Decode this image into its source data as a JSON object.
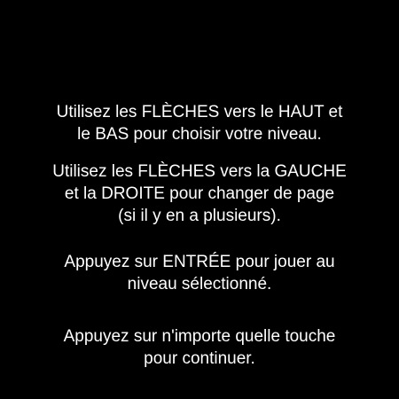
{
  "instructions": {
    "paragraphs": [
      {
        "lines": [
          "Utilisez les FLÈCHES vers le HAUT et",
          "le BAS pour choisir votre niveau."
        ]
      },
      {
        "lines": [
          "Utilisez les FLÈCHES vers la GAUCHE",
          "et la DROITE pour changer de page",
          "(si il y en a plusieurs)."
        ]
      },
      {
        "lines": [
          "Appuyez sur ENTRÉE pour jouer au",
          "niveau sélectionné."
        ]
      },
      {
        "lines": [
          "Appuyez sur n'importe quelle touche",
          "pour continuer."
        ]
      }
    ]
  },
  "colors": {
    "background": "#000000",
    "text": "#ffffff"
  }
}
